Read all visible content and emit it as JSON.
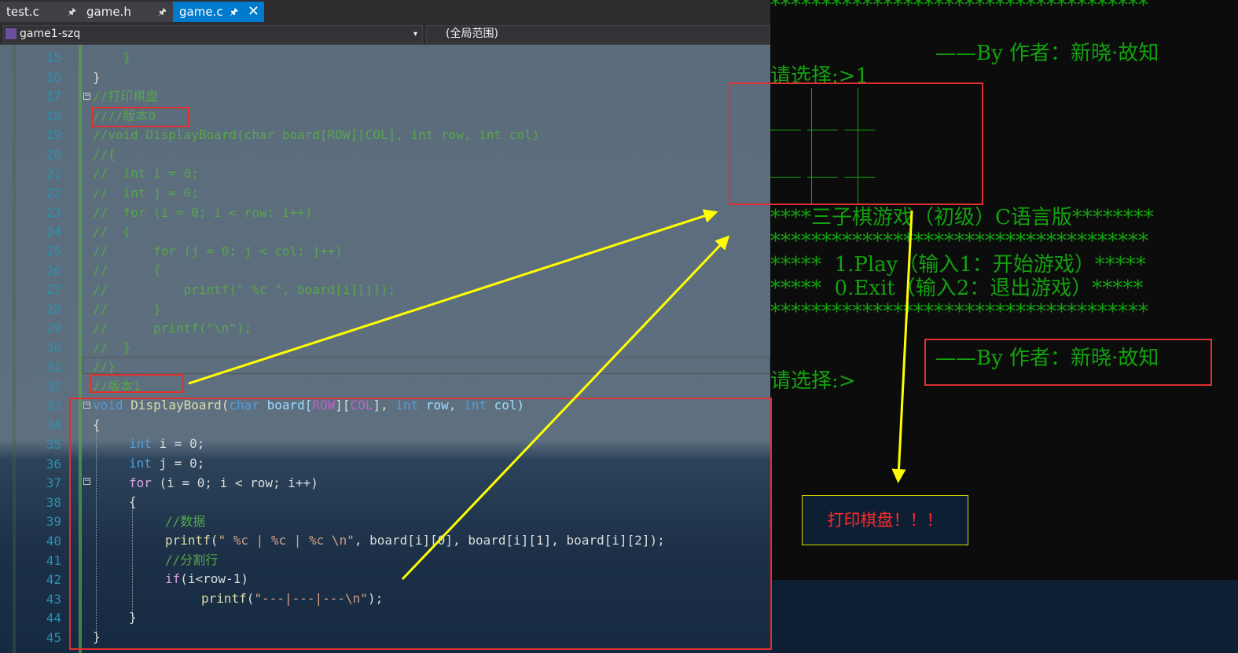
{
  "tabs": [
    {
      "label": "test.c",
      "pin": "🖈"
    },
    {
      "label": "game.h",
      "pin": "🖈"
    },
    {
      "label": "game.c",
      "pin": "🖈",
      "close": "✕"
    }
  ],
  "nav": {
    "project": "game1-szq",
    "scope": "(全局范围)"
  },
  "line_numbers": [
    "15",
    "16",
    "17",
    "18",
    "19",
    "20",
    "21",
    "22",
    "23",
    "24",
    "25",
    "26",
    "27",
    "28",
    "29",
    "30",
    "31",
    "32",
    "33",
    "34",
    "35",
    "36",
    "37",
    "38",
    "39",
    "40",
    "41",
    "42",
    "43",
    "44",
    "45"
  ],
  "code": {
    "l15": "    }",
    "l16": "}",
    "l17": "//打印棋盘",
    "l18": "////版本0",
    "l19": "//void DisplayBoard(char board[ROW][COL], int row, int col)",
    "l20": "//{",
    "l21": "//  int i = 0;",
    "l22": "//  int j = 0;",
    "l23": "//  for (i = 0; i < row; i++)",
    "l24": "//  {",
    "l25": "//      for (j = 0; j < col; j++)",
    "l26": "//      {",
    "l27": "//          printf(\" %c \", board[i][j]);",
    "l28": "//      }",
    "l29": "//      printf(\"\\n\");",
    "l30": "//  }",
    "l31": "//}",
    "l32": "//版本1",
    "l33": {
      "kw1": "void",
      "fn": "DisplayBoard",
      "p1": "(",
      "kw2": "char",
      "v1": " board[",
      "m1": "ROW",
      "p2": "][",
      "m2": "COL",
      "p3": "], ",
      "kw3": "int",
      "v2": " row, ",
      "kw4": "int",
      "v3": " col)"
    },
    "l34": "{",
    "l35": {
      "kw": "int",
      "rest": " i = 0;"
    },
    "l36": {
      "kw": "int",
      "rest": " j = 0;"
    },
    "l37": {
      "kw": "for",
      "rest": " (i = 0; i < row; i++)"
    },
    "l38": "{",
    "l39": "//数据",
    "l40": {
      "fn": "printf",
      "p1": "(",
      "st": "\" %c | %c | %c \\n\"",
      "rest": ", board[i][0], board[i][1], board[i][2]);"
    },
    "l41": "//分割行",
    "l42": {
      "kw": "if",
      "rest": "(i<row-1)"
    },
    "l43": {
      "fn": "printf",
      "p1": "(",
      "st": "\"---|---|---\\n\"",
      "rest": ");"
    },
    "l44": "}",
    "l45": "}"
  },
  "console": {
    "stars": "*************************************",
    "byline": "——By 作者：新晓·故知",
    "prompt_answered": "请选择:>1",
    "board_row": "___ ___ ___",
    "menu_title": "****三子棋游戏（初级）C语言版********",
    "menu_play": "*****  1.Play（输入1：开始游戏）*****",
    "menu_exit": "*****  0.Exit（输入2：退出游戏）*****",
    "prompt": "请选择:>"
  },
  "annotation": {
    "note": "打印棋盘！！！",
    "arrow_color": "#ffff00",
    "box_color": "#e03030"
  }
}
